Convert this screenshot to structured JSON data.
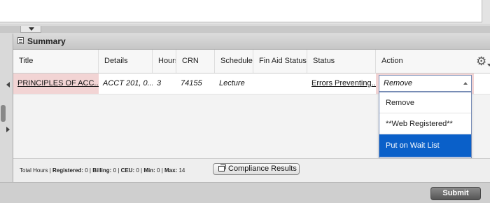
{
  "summary": {
    "title": "Summary",
    "columns": [
      "Title",
      "Details",
      "Hours",
      "CRN",
      "Schedule Type",
      "Fin Aid Status",
      "Status",
      "Action"
    ],
    "row": {
      "title": "PRINCIPLES OF ACC...",
      "details": "ACCT 201, 0...",
      "hours": "3",
      "crn": "74155",
      "schedule": "Lecture",
      "fin_aid": "",
      "status": "Errors Preventing...",
      "action_value": "Remove"
    },
    "action_options": [
      "Remove",
      "**Web Registered**",
      "Put on Wait List"
    ],
    "selected_option_index": 2
  },
  "footer": {
    "total_hours_label": "Total Hours",
    "registered_label": "Registered:",
    "registered_value": "0",
    "billing_label": "Billing:",
    "billing_value": "0",
    "ceu_label": "CEU:",
    "ceu_value": "0",
    "min_label": "Min:",
    "min_value": "0",
    "max_label": "Max:",
    "max_value": "14",
    "compliance_label": "Compliance Results"
  },
  "submit_label": "Submit",
  "icons": {
    "summary": "grid-panel-icon",
    "settings": "gear-icon",
    "compliance": "copy-windows-icon"
  },
  "colors": {
    "error_row": "#f2d4d4",
    "selected_option": "#0a60c9",
    "dropdown_border": "#7a8fb8"
  }
}
